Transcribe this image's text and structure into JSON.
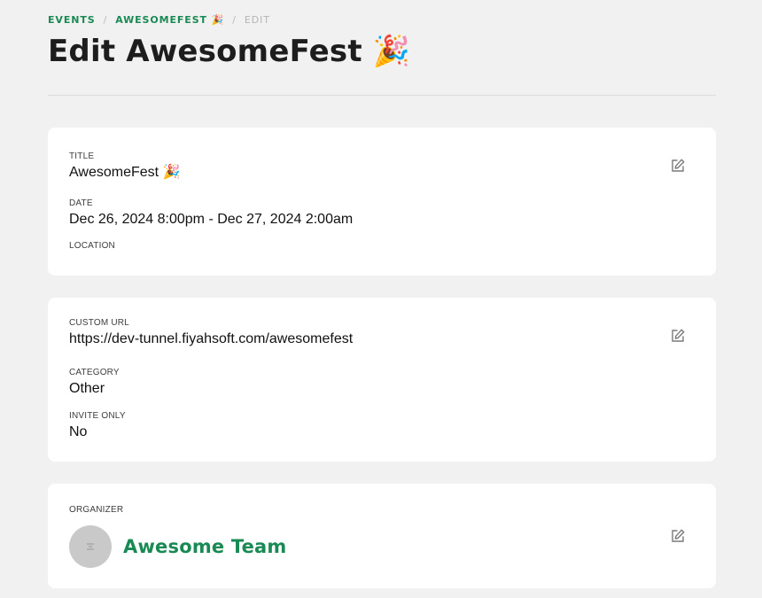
{
  "breadcrumb": {
    "events": "Events",
    "event": "AwesomeFest 🎉",
    "current": "Edit",
    "separator": "/"
  },
  "page": {
    "title": "Edit AwesomeFest 🎉"
  },
  "details_card": {
    "title_label": "Title",
    "title_value": "AwesomeFest 🎉",
    "date_label": "Date",
    "date_value": "Dec 26, 2024 8:00pm - Dec 27, 2024 2:00am",
    "location_label": "Location",
    "location_value": ""
  },
  "settings_card": {
    "url_label": "Custom URL",
    "url_value": "https://dev-tunnel.fiyahsoft.com/awesomefest",
    "category_label": "Category",
    "category_value": "Other",
    "invite_label": "Invite only",
    "invite_value": "No"
  },
  "organizer_card": {
    "label": "Organizer",
    "name": "Awesome Team"
  },
  "icons": {
    "edit": "edit-icon",
    "avatar": "avatar-placeholder-icon"
  },
  "colors": {
    "accent": "#1a8a55",
    "background": "#f0f1f0",
    "card": "#ffffff",
    "avatar": "#c9c9c9"
  }
}
